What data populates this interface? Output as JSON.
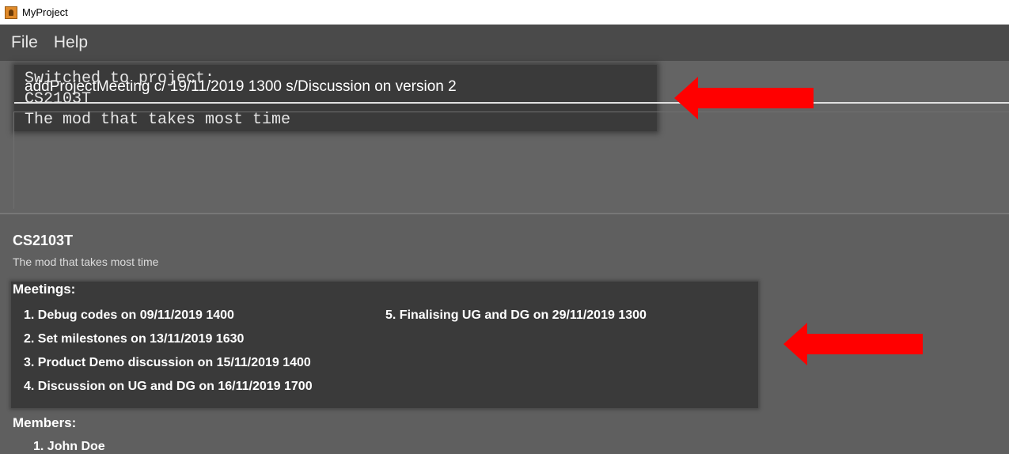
{
  "window": {
    "title": "MyProject"
  },
  "menu": {
    "file": "File",
    "help": "Help"
  },
  "command": {
    "value": "addProjectMeeting c/ 19/11/2019 1300 s/Discussion on version 2"
  },
  "result": {
    "lines": [
      "Switched to project:",
      "CS2103T",
      "The mod that takes most time"
    ]
  },
  "project": {
    "title": "CS2103T",
    "description": "The mod that takes most time",
    "meetings_label": "Meetings:",
    "meetings": [
      "1. Debug codes on 09/11/2019 1400",
      "2. Set milestones on 13/11/2019 1630",
      "3. Product Demo discussion on 15/11/2019 1400",
      "4. Discussion on UG and DG on 16/11/2019 1700",
      "5. Finalising UG and DG on 29/11/2019 1300"
    ],
    "members_label": "Members:",
    "members": [
      "1. John Doe"
    ]
  },
  "annotations": {
    "arrow_color": "#ff0000"
  }
}
